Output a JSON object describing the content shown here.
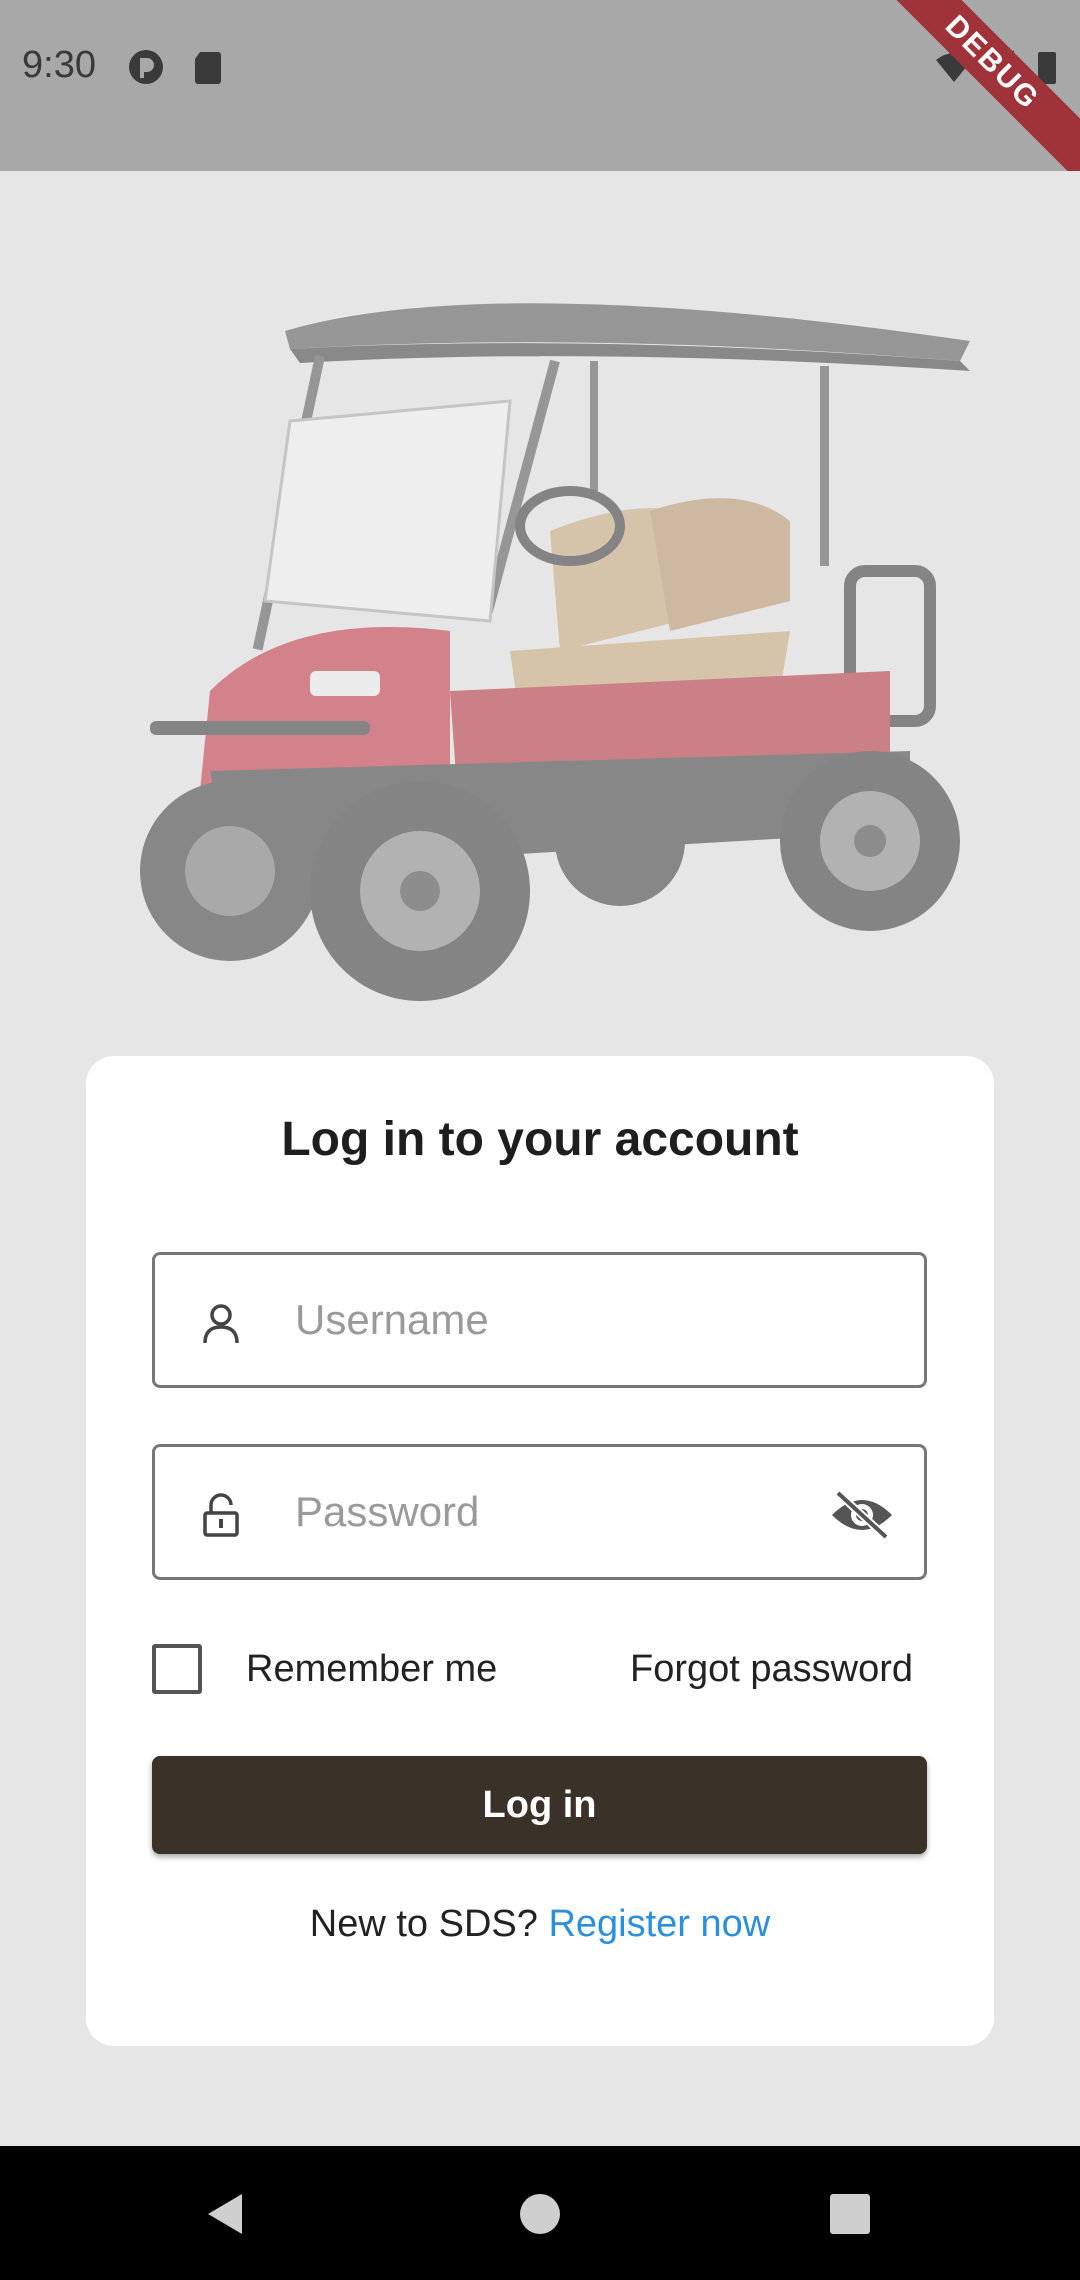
{
  "status_bar": {
    "time": "9:30",
    "debug_label": "DEBUG"
  },
  "hero": {
    "icon": "golf-cart-image"
  },
  "login_card": {
    "title": "Log in to your account",
    "username": {
      "placeholder": "Username",
      "value": "",
      "icon": "user-icon"
    },
    "password": {
      "placeholder": "Password",
      "value": "",
      "icon": "lock-icon",
      "visibility_icon": "eye-off-icon"
    },
    "remember_me": {
      "label": "Remember me",
      "checked": false
    },
    "forgot_password": "Forgot password",
    "login_button": "Log in",
    "register": {
      "prompt": "New to SDS? ",
      "link": "Register now"
    }
  },
  "colors": {
    "accent_button": "#3a3129",
    "link": "#2c8fdc",
    "debug_ribbon": "#a0323a"
  },
  "nav_bar": {
    "back_icon": "back-icon",
    "home_icon": "home-icon",
    "recents_icon": "recents-icon"
  }
}
